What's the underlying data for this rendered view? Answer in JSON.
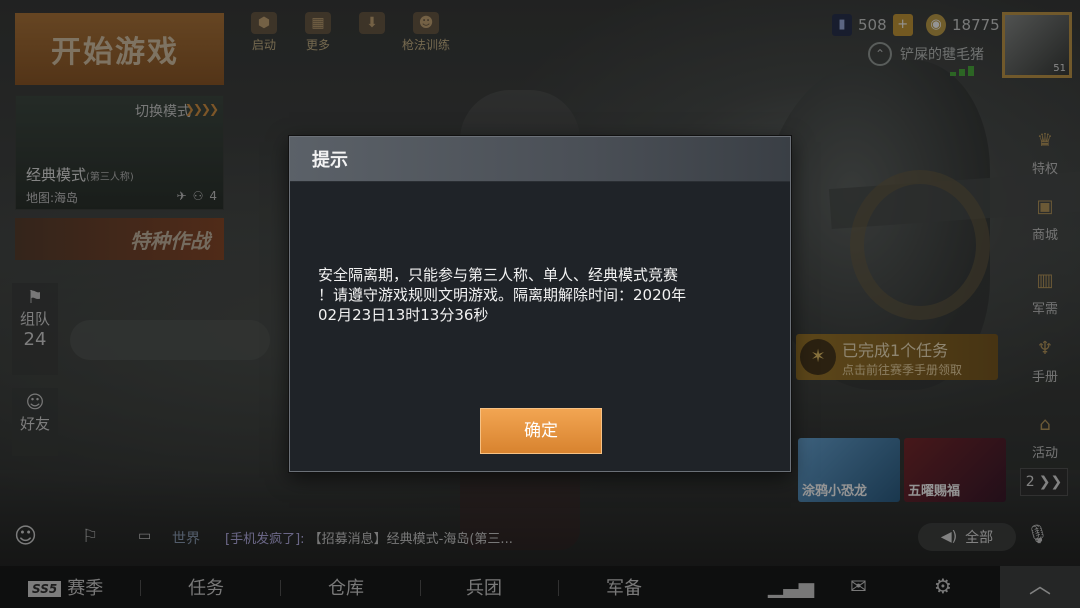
{
  "home": {
    "start_button": "开始游戏",
    "mode_switch": "切换模式",
    "mode_name": "经典模式",
    "mode_perspective": "(第三人称)",
    "mode_map": "地图:海岛",
    "team_size": "4",
    "special_ops": "特种作战",
    "top_icons": [
      {
        "label": "启动",
        "icon": "rocket-icon"
      },
      {
        "label": "更多",
        "icon": "grid-icon"
      },
      {
        "label": "",
        "icon": "download-icon"
      },
      {
        "label": "枪法训练",
        "icon": "trainer-icon"
      }
    ]
  },
  "status": {
    "coupons": "508",
    "coins": "18775",
    "player_name": "铲屎的毽毛猪",
    "level": "51"
  },
  "right_rail": [
    {
      "label": "特权",
      "icon": "crown-icon"
    },
    {
      "label": "商城",
      "icon": "bag-icon"
    },
    {
      "label": "军需",
      "icon": "crate-icon"
    },
    {
      "label": "手册",
      "icon": "trophy-icon"
    },
    {
      "label": "活动",
      "icon": "gift-icon"
    }
  ],
  "task": {
    "title": "已完成1个任务",
    "subtitle": "点击前往赛季手册领取"
  },
  "promos": [
    "涂鸦小恐龙",
    "五曜赐福"
  ],
  "promo_page": "2",
  "left_rail": {
    "team": {
      "label": "组队",
      "count": "24"
    },
    "friends": {
      "label": "好友"
    }
  },
  "chat": {
    "channel": "世界",
    "user": "[手机发疯了]:",
    "message": "【招募消息】经典模式-海岛(第三...",
    "voice_label": "全部"
  },
  "bottom_bar": {
    "season_badge": "SS5",
    "tabs": [
      "赛季",
      "任务",
      "仓库",
      "兵团",
      "军备"
    ]
  },
  "dialog": {
    "title": "提示",
    "message_line1": "安全隔离期，只能参与第三人称、单人、经典模式竞赛",
    "message_line2": "！请遵守游戏规则文明游戏。隔离期解除时间：2020年",
    "message_line3": "02月23日13时13分36秒",
    "ok_label": "确定"
  },
  "colors": {
    "accent_orange": "#e8943f",
    "dialog_bg": "#1f2328",
    "dialog_header": "#555b62"
  }
}
